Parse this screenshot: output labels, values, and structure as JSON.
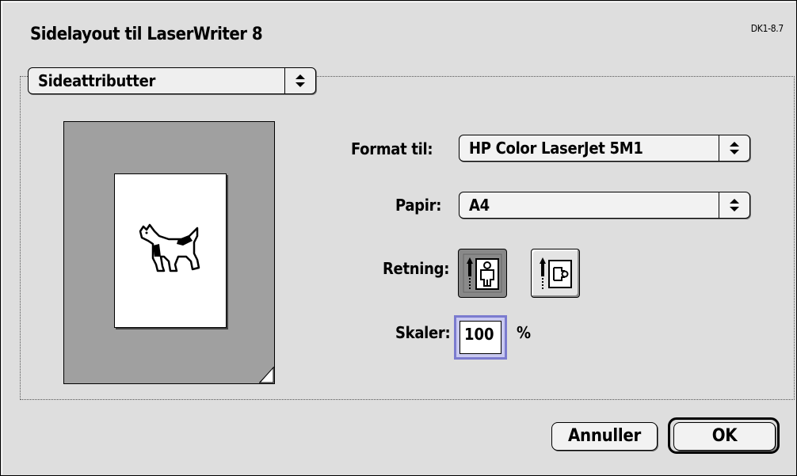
{
  "dialog": {
    "title": "Sidelayout til LaserWriter 8",
    "version": "DK1-8.7"
  },
  "section_popup": {
    "selected": "Sideattributter"
  },
  "format": {
    "label": "Format til:",
    "selected": "HP Color LaserJet 5M1"
  },
  "paper": {
    "label": "Papir:",
    "selected": "A4"
  },
  "orientation": {
    "label": "Retning:",
    "options": [
      "portrait-icon",
      "landscape-icon"
    ],
    "selected": "portrait"
  },
  "scale": {
    "label": "Skaler:",
    "value": "100",
    "unit": "%"
  },
  "buttons": {
    "cancel": "Annuller",
    "ok": "OK"
  }
}
